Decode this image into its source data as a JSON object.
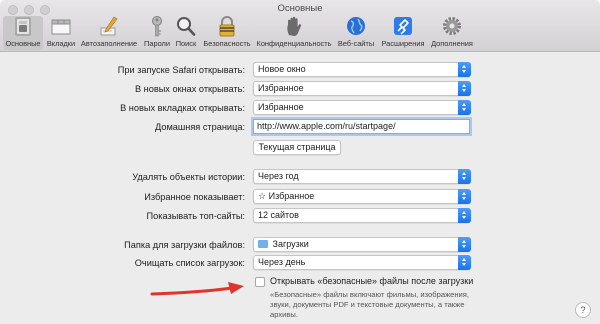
{
  "window": {
    "title": "Основные"
  },
  "toolbar": {
    "tabs": [
      {
        "label": "Основные",
        "icon": "general-switch-icon"
      },
      {
        "label": "Вкладки",
        "icon": "tabs-icon"
      },
      {
        "label": "Автозаполнение",
        "icon": "pencil-icon"
      },
      {
        "label": "Пароли",
        "icon": "key-icon"
      },
      {
        "label": "Поиск",
        "icon": "magnifier-icon"
      },
      {
        "label": "Безопасность",
        "icon": "lock-icon"
      },
      {
        "label": "Конфиденциальность",
        "icon": "hand-icon"
      },
      {
        "label": "Веб-сайты",
        "icon": "globe-icon"
      },
      {
        "label": "Расширения",
        "icon": "puzzle-icon"
      },
      {
        "label": "Дополнения",
        "icon": "gear-icon"
      }
    ]
  },
  "form": {
    "safari_opens_label": "При запуске Safari открывать:",
    "safari_opens_value": "Новое окно",
    "new_windows_label": "В новых окнах открывать:",
    "new_windows_value": "Избранное",
    "new_tabs_label": "В новых вкладках открывать:",
    "new_tabs_value": "Избранное",
    "homepage_label": "Домашняя страница:",
    "homepage_value": "http://www.apple.com/ru/startpage/",
    "current_page_button": "Текущая страница",
    "remove_history_label": "Удалять объекты истории:",
    "remove_history_value": "Через год",
    "favorites_shows_label": "Избранное показывает:",
    "favorites_shows_value": "Избранное",
    "top_sites_label": "Показывать топ-сайты:",
    "top_sites_value": "12 сайтов",
    "download_folder_label": "Папка для загрузки файлов:",
    "download_folder_value": "Загрузки",
    "clear_downloads_label": "Очищать список загрузок:",
    "clear_downloads_value": "Через день",
    "safe_files_label": "Открывать «безопасные» файлы после загрузки",
    "safe_files_note": "«Безопасные» файлы включают фильмы, изображения, звуки, документы PDF и текстовые документы, а также архивы.",
    "safe_files_checked": false
  },
  "help": {
    "label": "?"
  },
  "colors": {
    "accent": "#1773ec",
    "annotation_arrow": "#e0352b"
  }
}
